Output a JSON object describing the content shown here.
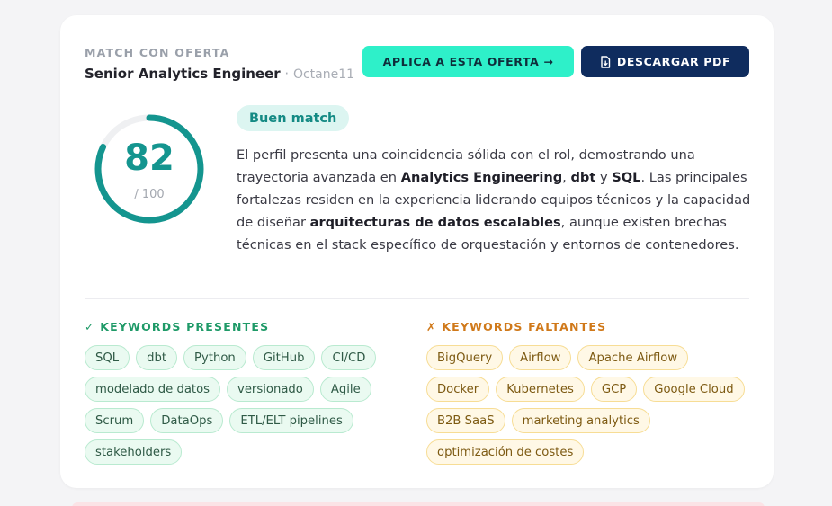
{
  "colors": {
    "accent_teal": "#14958f",
    "apply_button": "#2ef0c9",
    "pdf_button": "#0f2c5e",
    "present_green": "#1f9a68",
    "missing_orange": "#d0791a"
  },
  "header": {
    "label": "MATCH CON OFERTA",
    "role": "Senior Analytics Engineer",
    "separator": " · ",
    "company": "Octane11"
  },
  "buttons": {
    "apply_label": "APLICA A ESTA OFERTA →",
    "pdf_label": "DESCARGAR PDF",
    "pdf_icon": "file-download-icon"
  },
  "score": {
    "value": "82",
    "max": "/ 100",
    "fraction": 0.82
  },
  "match_badge": "Buen match",
  "summary": {
    "t1": "El perfil presenta una coincidencia sólida con el rol, demostrando una trayectoria avanzada en ",
    "b1": "Analytics Engineering",
    "t2": ", ",
    "b2": "dbt",
    "t3": " y ",
    "b3": "SQL",
    "t4": ". Las principales fortalezas residen en la experiencia liderando equipos técnicos y la capacidad de diseñar ",
    "b4": "arquitecturas de datos escalables",
    "t5": ", aunque existen brechas técnicas en el stack específico de orquestación y entornos de contenedores."
  },
  "keywords_present": {
    "title": "✓ KEYWORDS PRESENTES",
    "items": [
      "SQL",
      "dbt",
      "Python",
      "GitHub",
      "CI/CD",
      "modelado de datos",
      "versionado",
      "Agile",
      "Scrum",
      "DataOps",
      "ETL/ELT pipelines",
      "stakeholders"
    ]
  },
  "keywords_missing": {
    "title": "✗ KEYWORDS FALTANTES",
    "items": [
      "BigQuery",
      "Airflow",
      "Apache Airflow",
      "Docker",
      "Kubernetes",
      "GCP",
      "Google Cloud",
      "B2B SaaS",
      "marketing analytics",
      "optimización de costes"
    ]
  }
}
